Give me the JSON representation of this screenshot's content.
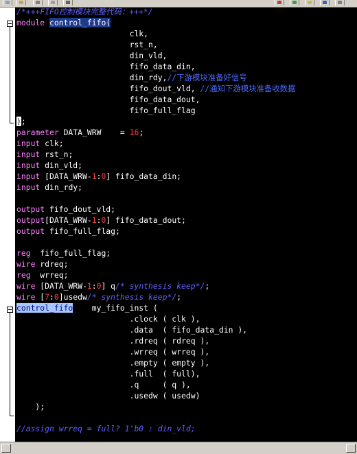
{
  "editor": {
    "lines": [
      {
        "tokens": [
          {
            "t": "/*+++FIFO控制模块完整代码：+++*/",
            "c": "cmt"
          }
        ]
      },
      {
        "tokens": [
          {
            "t": "module ",
            "c": "kw"
          },
          {
            "t": "control_fifo",
            "c": "sel"
          },
          {
            "t": "(",
            "c": "sel"
          }
        ]
      },
      {
        "tokens": [
          {
            "t": "                        clk,",
            "c": "id"
          }
        ]
      },
      {
        "tokens": [
          {
            "t": "                        rst_n,",
            "c": "id"
          }
        ]
      },
      {
        "tokens": [
          {
            "t": "                        din_vld,",
            "c": "id"
          }
        ]
      },
      {
        "tokens": [
          {
            "t": "                        fifo_data_din,",
            "c": "id"
          }
        ]
      },
      {
        "tokens": [
          {
            "t": "                        din_rdy,",
            "c": "id"
          },
          {
            "t": "//下游模块准备好信号",
            "c": "cmt-cn"
          }
        ]
      },
      {
        "tokens": [
          {
            "t": "                        fifo_dout_vld, ",
            "c": "id"
          },
          {
            "t": "//通知下游模块准备收数据",
            "c": "cmt-cn"
          }
        ]
      },
      {
        "tokens": [
          {
            "t": "                        fifo_data_dout,",
            "c": "id"
          }
        ]
      },
      {
        "tokens": [
          {
            "t": "                        fifo_full_flag",
            "c": "id"
          }
        ]
      },
      {
        "tokens": [
          {
            "t": ")",
            "c": "cursor-box"
          },
          {
            "t": ";",
            "c": "id"
          }
        ]
      },
      {
        "tokens": [
          {
            "t": "parameter ",
            "c": "kw"
          },
          {
            "t": "DATA_WRW    = ",
            "c": "id"
          },
          {
            "t": "16",
            "c": "num"
          },
          {
            "t": ";",
            "c": "id"
          }
        ]
      },
      {
        "tokens": [
          {
            "t": "input ",
            "c": "kw"
          },
          {
            "t": "clk;",
            "c": "id"
          }
        ]
      },
      {
        "tokens": [
          {
            "t": "input ",
            "c": "kw"
          },
          {
            "t": "rst_n;",
            "c": "id"
          }
        ]
      },
      {
        "tokens": [
          {
            "t": "input ",
            "c": "kw"
          },
          {
            "t": "din_vld;",
            "c": "id"
          }
        ]
      },
      {
        "tokens": [
          {
            "t": "input ",
            "c": "kw"
          },
          {
            "t": "[DATA_WRW-",
            "c": "id"
          },
          {
            "t": "1",
            "c": "num"
          },
          {
            "t": ":",
            "c": "id"
          },
          {
            "t": "0",
            "c": "num"
          },
          {
            "t": "] fifo_data_din;",
            "c": "id"
          }
        ]
      },
      {
        "tokens": [
          {
            "t": "input ",
            "c": "kw"
          },
          {
            "t": "din_rdy;",
            "c": "id"
          }
        ]
      },
      {
        "tokens": [
          {
            "t": "",
            "c": "id"
          }
        ]
      },
      {
        "tokens": [
          {
            "t": "output ",
            "c": "kw"
          },
          {
            "t": "fifo_dout_vld;",
            "c": "id"
          }
        ]
      },
      {
        "tokens": [
          {
            "t": "output",
            "c": "kw"
          },
          {
            "t": "[DATA_WRW-",
            "c": "id"
          },
          {
            "t": "1",
            "c": "num"
          },
          {
            "t": ":",
            "c": "id"
          },
          {
            "t": "0",
            "c": "num"
          },
          {
            "t": "] fifo_data_dout;",
            "c": "id"
          }
        ]
      },
      {
        "tokens": [
          {
            "t": "output ",
            "c": "kw"
          },
          {
            "t": "fifo_full_flag;",
            "c": "id"
          }
        ]
      },
      {
        "tokens": [
          {
            "t": "",
            "c": "id"
          }
        ]
      },
      {
        "tokens": [
          {
            "t": "reg  ",
            "c": "kw"
          },
          {
            "t": "fifo_full_flag;",
            "c": "id"
          }
        ]
      },
      {
        "tokens": [
          {
            "t": "wire ",
            "c": "kw"
          },
          {
            "t": "rdreq;",
            "c": "id"
          }
        ]
      },
      {
        "tokens": [
          {
            "t": "reg  ",
            "c": "kw"
          },
          {
            "t": "wrreq;",
            "c": "id"
          }
        ]
      },
      {
        "tokens": [
          {
            "t": "wire ",
            "c": "kw"
          },
          {
            "t": "[DATA_WRW-",
            "c": "id"
          },
          {
            "t": "1",
            "c": "num"
          },
          {
            "t": ":",
            "c": "id"
          },
          {
            "t": "0",
            "c": "num"
          },
          {
            "t": "] q",
            "c": "id"
          },
          {
            "t": "/* synthesis keep*/",
            "c": "cmt"
          },
          {
            "t": ";",
            "c": "id"
          }
        ]
      },
      {
        "tokens": [
          {
            "t": "wire ",
            "c": "kw"
          },
          {
            "t": "[",
            "c": "id"
          },
          {
            "t": "7",
            "c": "num"
          },
          {
            "t": ":",
            "c": "id"
          },
          {
            "t": "0",
            "c": "num"
          },
          {
            "t": "]usedw",
            "c": "id"
          },
          {
            "t": "/* synthesis keep*/",
            "c": "cmt"
          },
          {
            "t": ";",
            "c": "id"
          }
        ]
      },
      {
        "tokens": [
          {
            "t": "control_fifo",
            "c": "sel2"
          },
          {
            "t": "    my_fifo_inst (",
            "c": "id"
          }
        ]
      },
      {
        "tokens": [
          {
            "t": "                        .clock ( clk ),",
            "c": "id"
          }
        ]
      },
      {
        "tokens": [
          {
            "t": "                        .data  ( fifo_data_din ),",
            "c": "id"
          }
        ]
      },
      {
        "tokens": [
          {
            "t": "                        .rdreq ( rdreq ),",
            "c": "id"
          }
        ]
      },
      {
        "tokens": [
          {
            "t": "                        .wrreq ( wrreq ),",
            "c": "id"
          }
        ]
      },
      {
        "tokens": [
          {
            "t": "                        .empty ( empty ),",
            "c": "id"
          }
        ]
      },
      {
        "tokens": [
          {
            "t": "                        .full  ( full),",
            "c": "id"
          }
        ]
      },
      {
        "tokens": [
          {
            "t": "                        .q     ( q ),",
            "c": "id"
          }
        ]
      },
      {
        "tokens": [
          {
            "t": "                        .usedw ( usedw)",
            "c": "id"
          }
        ]
      },
      {
        "tokens": [
          {
            "t": "    );",
            "c": "id"
          }
        ]
      },
      {
        "tokens": [
          {
            "t": "",
            "c": "id"
          }
        ]
      },
      {
        "tokens": [
          {
            "t": "//assign wrreq = full? 1'b0 : din_vld;",
            "c": "cmt"
          }
        ]
      }
    ]
  }
}
